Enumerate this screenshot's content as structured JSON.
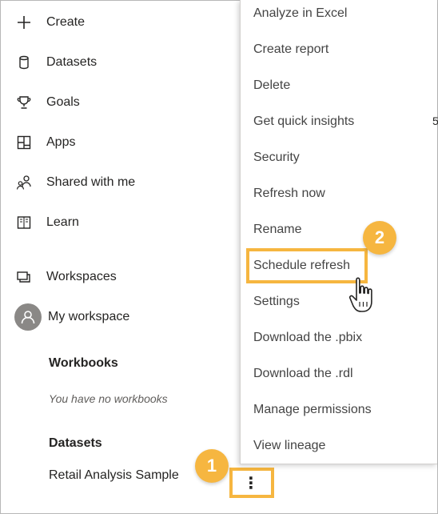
{
  "nav": {
    "create": "Create",
    "datasets": "Datasets",
    "goals": "Goals",
    "apps": "Apps",
    "shared": "Shared with me",
    "learn": "Learn",
    "workspaces": "Workspaces",
    "my_workspace": "My workspace"
  },
  "workspace": {
    "workbooks_title": "Workbooks",
    "workbooks_empty": "You have no workbooks",
    "datasets_title": "Datasets",
    "dataset_name": "Retail Analysis Sample",
    "more_options": "⋮"
  },
  "menu": {
    "items": [
      "Analyze in Excel",
      "Create report",
      "Delete",
      "Get quick insights",
      "Security",
      "Refresh now",
      "Rename",
      "Schedule refresh",
      "Settings",
      "Download the .pbix",
      "Download the .rdl",
      "Manage permissions",
      "View lineage"
    ]
  },
  "callouts": {
    "step1": "1",
    "step2": "2"
  },
  "edge_text": "5",
  "colors": {
    "highlight": "#f6b640",
    "text": "#252423",
    "menu_text": "#444444"
  },
  "icons": {
    "create": "plus-icon",
    "datasets": "database-icon",
    "goals": "trophy-icon",
    "apps": "apps-icon",
    "shared": "shared-people-icon",
    "learn": "book-icon",
    "workspaces": "workspaces-icon",
    "my_workspace": "avatar-icon"
  }
}
